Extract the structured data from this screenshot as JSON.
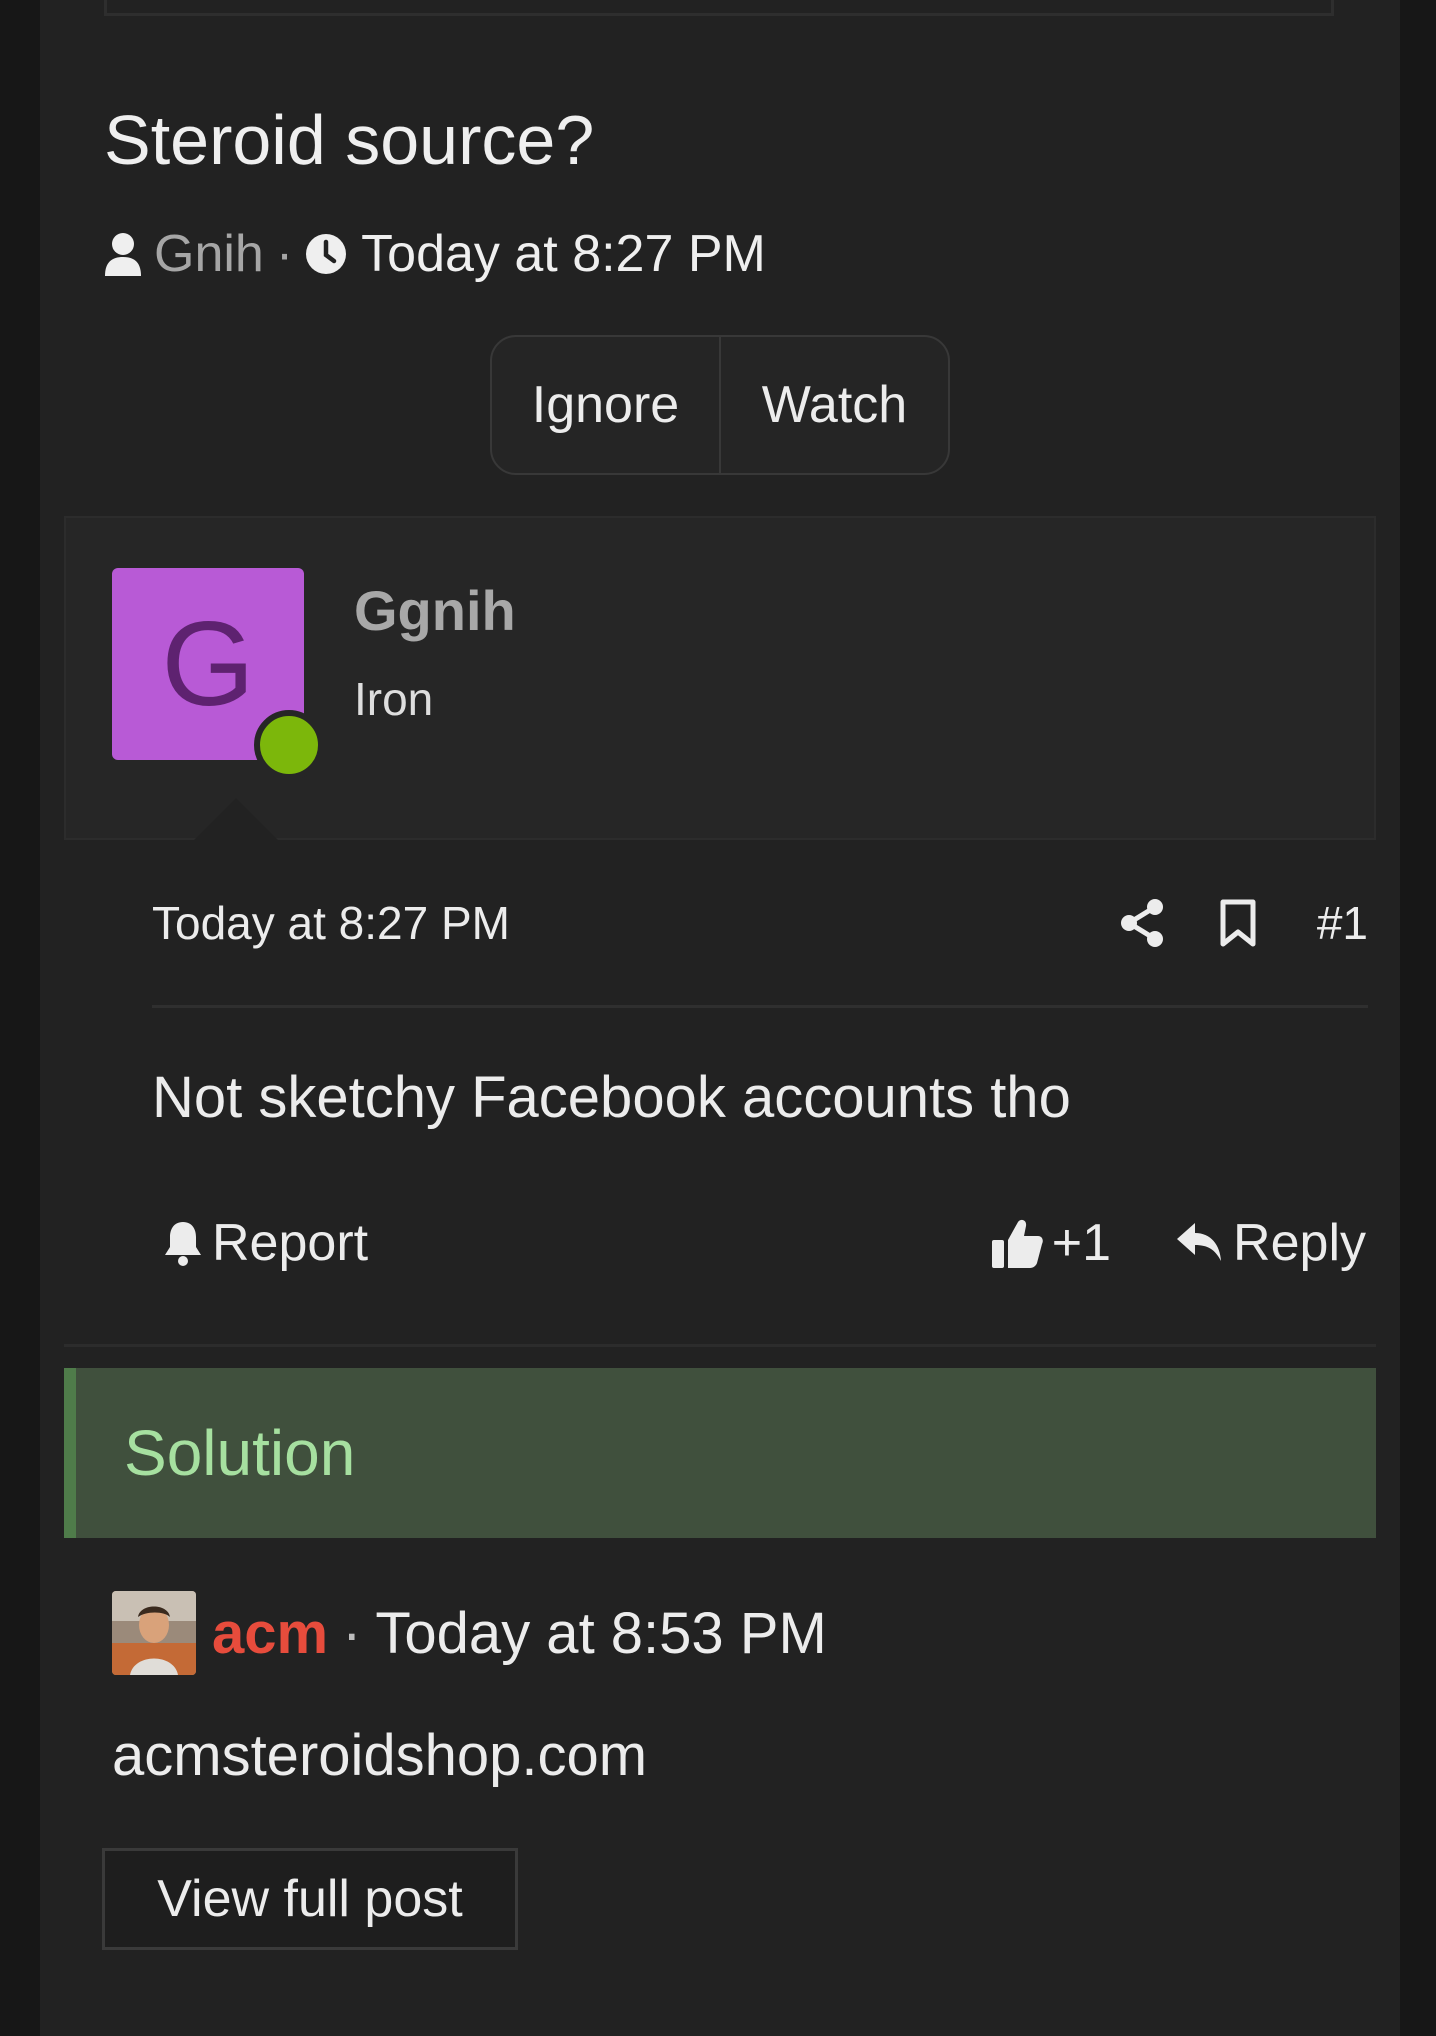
{
  "thread": {
    "title": "Steroid source?",
    "author": "Gnih",
    "separator": "·",
    "time": "Today at 8:27 PM",
    "icons": [
      "user-icon",
      "clock-icon"
    ]
  },
  "thread_actions": {
    "ignore_label": "Ignore",
    "watch_label": "Watch"
  },
  "post": {
    "user": {
      "avatar_letter": "G",
      "name": "Ggnih",
      "title": "Iron",
      "avatar_color": "#b85ad6",
      "online_color": "#7cb70b"
    },
    "time": "Today at 8:27 PM",
    "number": "#1",
    "body": "Not sketchy Facebook accounts tho",
    "actions": {
      "report_label": "Report",
      "like_count": "+1",
      "reply_label": "Reply"
    },
    "icons": [
      "share-icon",
      "bookmark-icon",
      "bell-icon",
      "thumbs-up-icon",
      "reply-icon"
    ]
  },
  "solution": {
    "label": "Solution",
    "author": "acm",
    "separator": "·",
    "time": "Today at 8:53 PM",
    "body": "acmsteroidshop.com",
    "view_button": "View full post",
    "author_color": "#e74c3c",
    "accent_color": "#4f7c4a"
  }
}
